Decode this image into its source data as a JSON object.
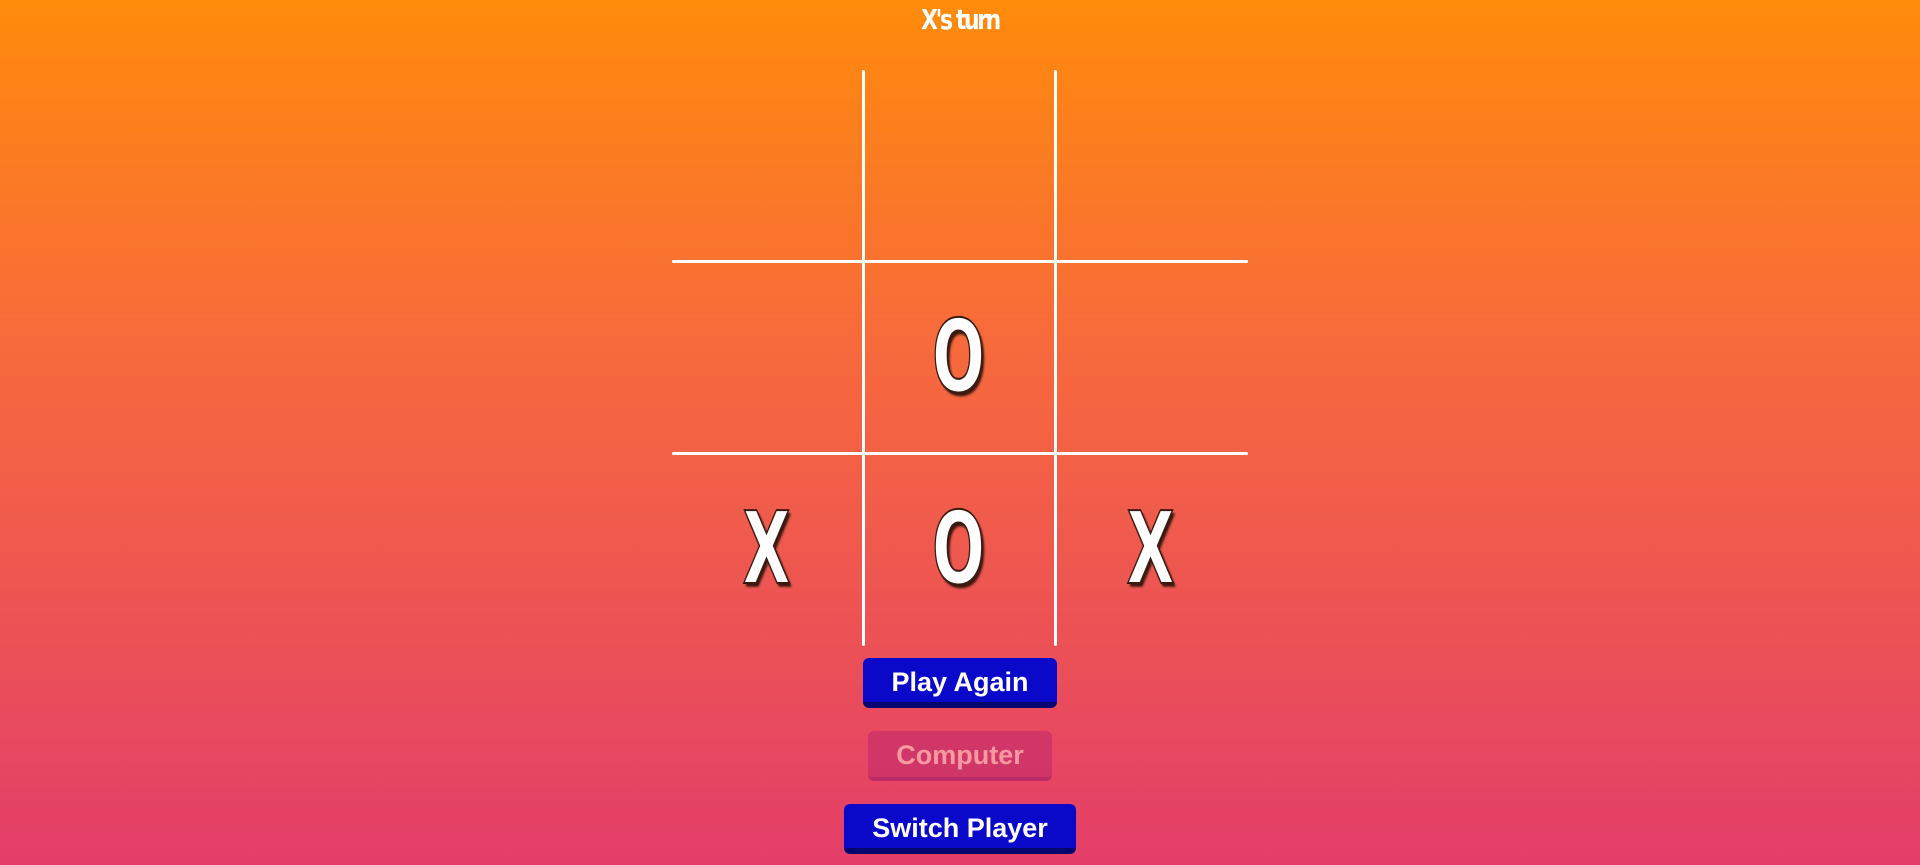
{
  "status": {
    "turn_text": "X's turn"
  },
  "board": {
    "cells": [
      "",
      "",
      "",
      "",
      "O",
      "",
      "X",
      "O",
      "X"
    ]
  },
  "buttons": {
    "play_again": "Play Again",
    "computer": "Computer",
    "switch_player": "Switch Player"
  },
  "colors": {
    "background_top": "#ff8b0a",
    "background_bottom": "#e33e6a",
    "button_primary": "#0a08c9",
    "mark": "#ffffff"
  }
}
